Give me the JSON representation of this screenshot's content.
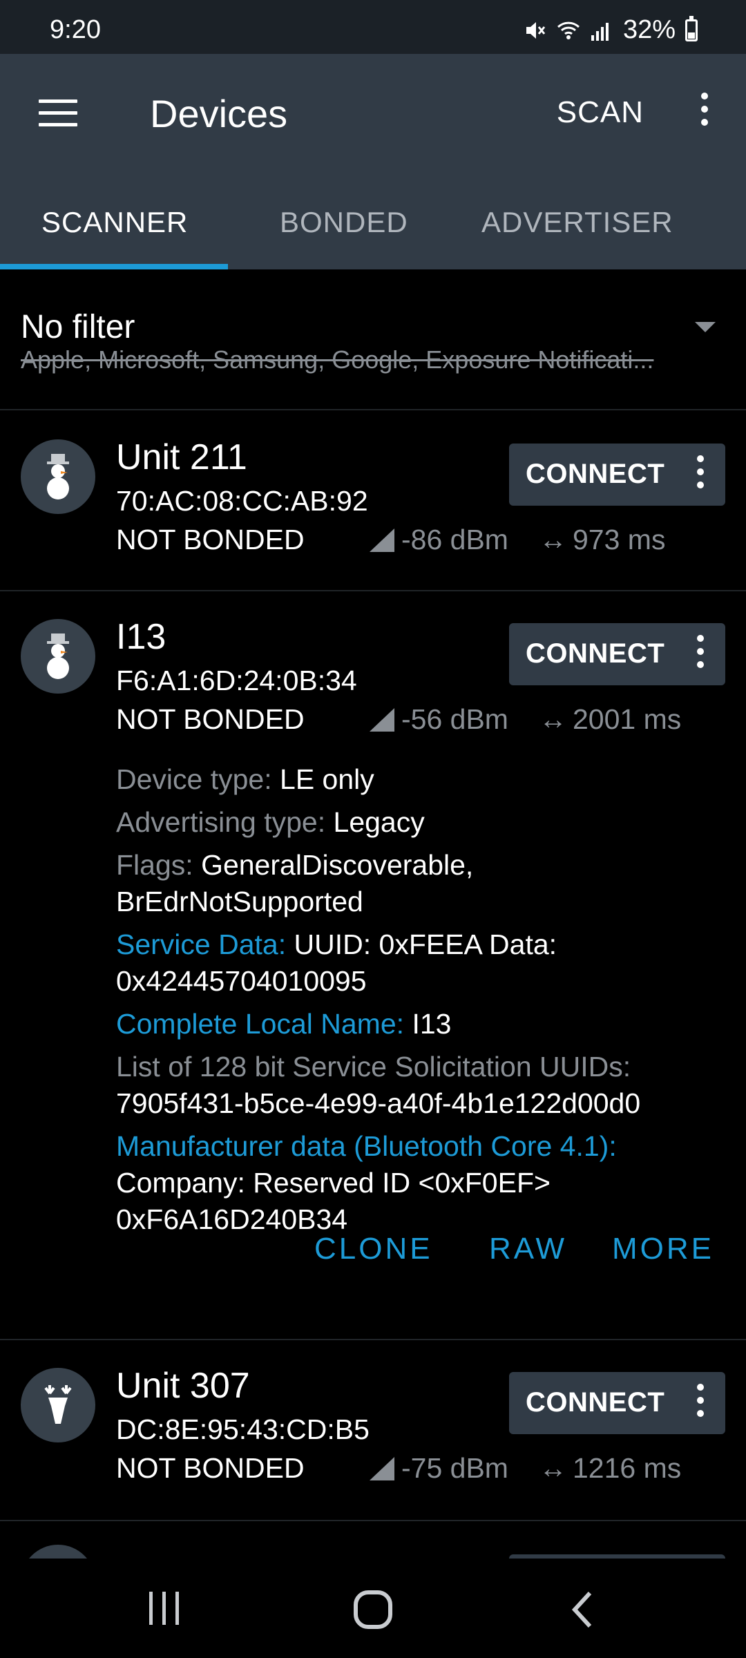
{
  "status_bar": {
    "time": "9:20",
    "battery": "32%",
    "battery_level": 0.32,
    "icons": [
      "mute-icon",
      "wifi-icon",
      "signal-icon",
      "battery-icon"
    ]
  },
  "app_bar": {
    "title": "Devices",
    "scan_label": "SCAN"
  },
  "tabs": [
    {
      "label": "SCANNER",
      "active": true
    },
    {
      "label": "BONDED",
      "active": false
    },
    {
      "label": "ADVERTISER",
      "active": false
    }
  ],
  "filter": {
    "title": "No filter",
    "excluded": "Apple, Microsoft, Samsung, Google, Exposure Notificati..."
  },
  "devices": [
    {
      "name": "Unit 211",
      "mac": "70:AC:08:CC:AB:92",
      "bond": "NOT BONDED",
      "rssi": "-86 dBm",
      "interval": "973 ms",
      "icon": "snowman-icon",
      "connect_label": "CONNECT"
    },
    {
      "name": "I13",
      "mac": "F6:A1:6D:24:0B:34",
      "bond": "NOT BONDED",
      "rssi": "-56 dBm",
      "interval": "2001 ms",
      "icon": "snowman-icon",
      "connect_label": "CONNECT",
      "details": {
        "device_type_label": "Device type:",
        "device_type": "LE only",
        "adv_type_label": "Advertising type:",
        "adv_type": "Legacy",
        "flags_label": "Flags:",
        "flags": "GeneralDiscoverable, BrEdrNotSupported",
        "service_data_label": "Service Data:",
        "service_data": "UUID: 0xFEEA Data: 0x42445704010095",
        "local_name_label": "Complete Local Name:",
        "local_name": "I13",
        "solicitation_label": "List of 128 bit Service Solicitation UUIDs:",
        "solicitation": "7905f431-b5ce-4e99-a40f-4b1e122d00d0",
        "manufacturer_label": "Manufacturer data (Bluetooth Core 4.1):",
        "manufacturer_line1": "Company: Reserved ID <0xF0EF>",
        "manufacturer_line2": "0xF6A16D240B34"
      },
      "actions": {
        "clone": "CLONE",
        "raw": "RAW",
        "more": "MORE"
      }
    },
    {
      "name": "Unit 307",
      "mac": "DC:8E:95:43:CD:B5",
      "bond": "NOT BONDED",
      "rssi": "-75 dBm",
      "interval": "1216 ms",
      "icon": "deer-icon",
      "connect_label": "CONNECT"
    }
  ],
  "colors": {
    "app_bar": "#313b46",
    "accent": "#1d9bd7",
    "background": "#000000",
    "secondary_text": "#8a8f95"
  }
}
